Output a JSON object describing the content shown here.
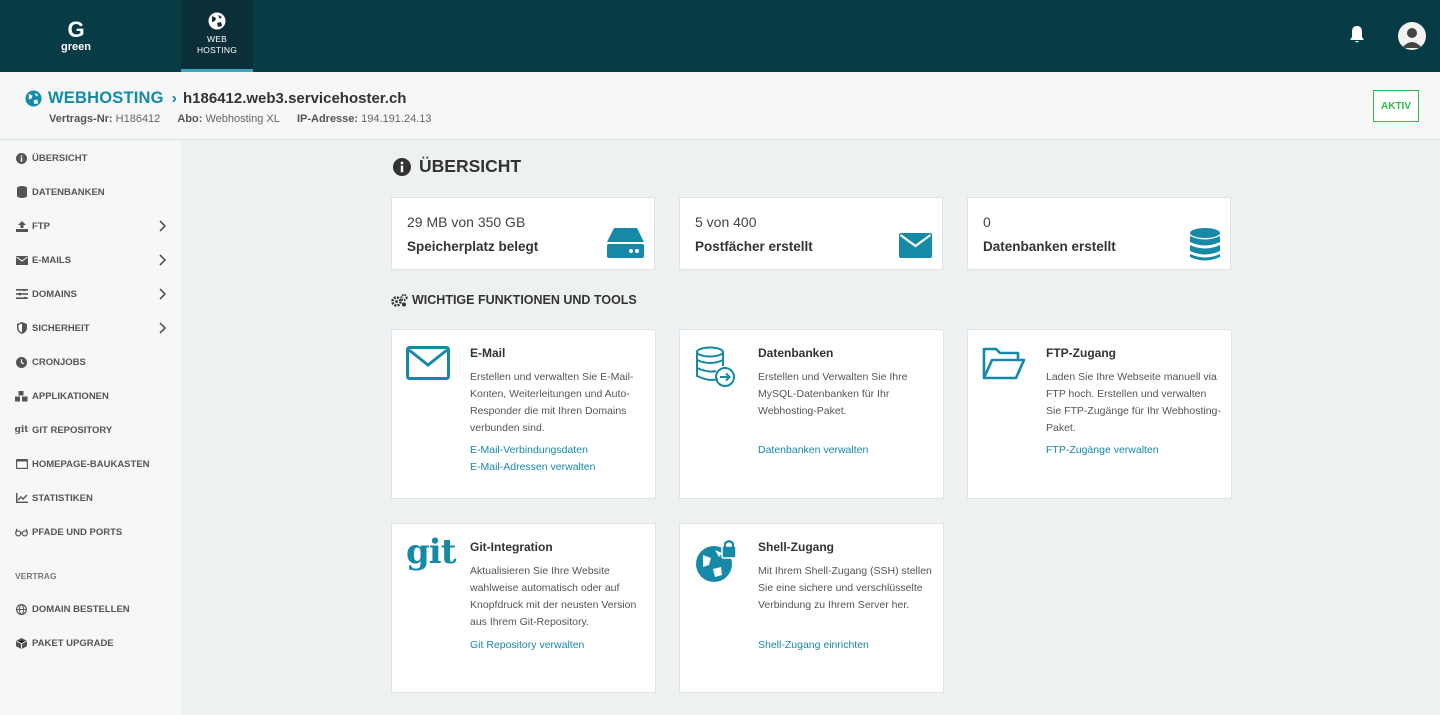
{
  "topbar": {
    "logo_letter": "G",
    "logo_text": "green",
    "tab_label_1": "WEB",
    "tab_label_2": "HOSTING"
  },
  "header": {
    "section": "WEBHOSTING",
    "host": "h186412.web3.servicehoster.ch",
    "contract_label": "Vertrags-Nr:",
    "contract_value": "H186412",
    "abo_label": "Abo:",
    "abo_value": "Webhosting XL",
    "ip_label": "IP-Adresse:",
    "ip_value": "194.191.24.13",
    "status": "AKTIV"
  },
  "sidebar": {
    "items": [
      {
        "label": "ÜBERSICHT",
        "icon": "info-circle-icon"
      },
      {
        "label": "DATENBANKEN",
        "icon": "database-icon"
      },
      {
        "label": "FTP",
        "icon": "upload-icon"
      },
      {
        "label": "E-MAILS",
        "icon": "envelope-icon"
      },
      {
        "label": "DOMAINS",
        "icon": "sliders-icon"
      },
      {
        "label": "SICHERHEIT",
        "icon": "shield-icon"
      },
      {
        "label": "CRONJOBS",
        "icon": "clock-icon"
      },
      {
        "label": "APPLIKATIONEN",
        "icon": "cubes-icon"
      },
      {
        "label": "GIT REPOSITORY",
        "icon": "git-icon"
      },
      {
        "label": "HOMEPAGE-BAUKASTEN",
        "icon": "window-icon"
      },
      {
        "label": "STATISTIKEN",
        "icon": "chart-line-icon"
      },
      {
        "label": "PFADE UND PORTS",
        "icon": "glasses-icon"
      }
    ],
    "section_contract": "VERTRAG",
    "contract_items": [
      {
        "label": "DOMAIN BESTELLEN",
        "icon": "globe-icon"
      },
      {
        "label": "PAKET UPGRADE",
        "icon": "box-icon"
      }
    ]
  },
  "main": {
    "title": "ÜBERSICHT",
    "stats": [
      {
        "value": "29 MB von 350 GB",
        "label": "Speicherplatz belegt",
        "icon": "hdd-icon"
      },
      {
        "value": "5 von 400",
        "label": "Postfächer erstellt",
        "icon": "envelope-icon"
      },
      {
        "value": "0",
        "label": "Datenbanken erstellt",
        "icon": "database-icon"
      }
    ],
    "tools_title": "WICHTIGE FUNKTIONEN UND TOOLS",
    "cards": [
      {
        "title": "E-Mail",
        "desc": "Erstellen und verwalten Sie E-Mail-Konten, Weiterleitungen und Auto-Responder die mit Ihren Domains verbunden sind.",
        "links": [
          "E-Mail-Verbindungsdaten",
          "E-Mail-Adressen verwalten"
        ]
      },
      {
        "title": "Datenbanken",
        "desc": "Erstellen und Verwalten Sie Ihre MySQL-Datenbanken für Ihr Webhosting-Paket.",
        "links": [
          "Datenbanken verwalten"
        ]
      },
      {
        "title": "FTP-Zugang",
        "desc": "Laden Sie Ihre Webseite manuell via FTP hoch. Erstellen und verwalten Sie FTP-Zugänge für Ihr Webhosting-Paket.",
        "links": [
          "FTP-Zugänge verwalten"
        ]
      },
      {
        "title": "Git-Integration",
        "desc": "Aktualisieren Sie Ihre Website wahlweise automatisch oder auf Knopfdruck mit der neusten Version aus Ihrem Git-Repository.",
        "links": [
          "Git Repository verwalten"
        ],
        "icon_text": "git"
      },
      {
        "title": "Shell-Zugang",
        "desc": "Mit Ihrem Shell-Zugang (SSH) stellen Sie eine sichere und verschlüsselte Verbindung zu Ihrem Server her.",
        "links": [
          "Shell-Zugang einrichten"
        ]
      }
    ]
  },
  "colors": {
    "topbar": "#073c47",
    "accent": "#1689a6",
    "status_green": "#2fbb4f"
  }
}
